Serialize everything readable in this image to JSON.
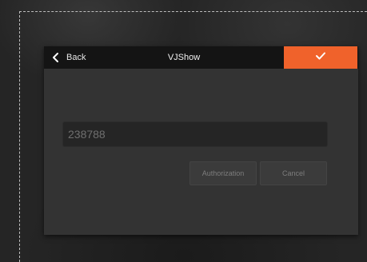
{
  "dialog": {
    "title": "VJShow",
    "back_label": "Back",
    "confirm_icon": "checkmark-icon",
    "back_icon": "chevron-left-icon"
  },
  "form": {
    "code_value": "238788",
    "authorization_label": "Authorization",
    "cancel_label": "Cancel"
  },
  "colors": {
    "accent": "#f0622b",
    "titlebar": "#141414",
    "dialog_bg": "#333333"
  }
}
